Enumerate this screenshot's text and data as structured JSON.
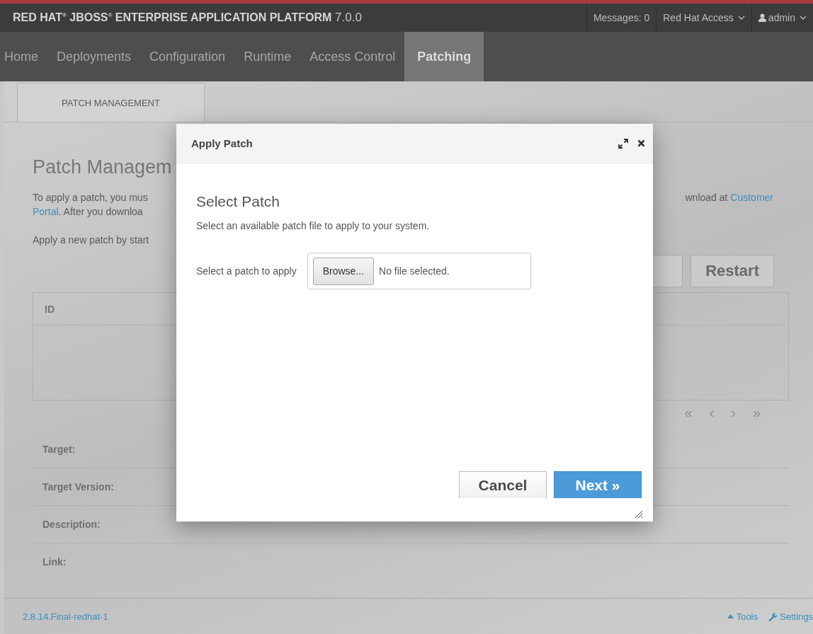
{
  "header": {
    "brand": "RED HAT$^{®}$ JBOSS$^{®}$ ENTERPRISE APPLICATION PLATFORM",
    "version": "7.0.0",
    "messages": "Messages: 0",
    "access_menu": "Red Hat Access",
    "user_menu": "admin"
  },
  "nav": [
    {
      "label": "Home",
      "selected": false
    },
    {
      "label": "Deployments",
      "selected": false
    },
    {
      "label": "Configuration",
      "selected": false
    },
    {
      "label": "Runtime",
      "selected": false
    },
    {
      "label": "Access Control",
      "selected": false
    },
    {
      "label": "Patching",
      "selected": true
    }
  ],
  "page_tabs": [
    {
      "label": "PATCH MANAGEMENT",
      "selected": true
    }
  ],
  "background": {
    "heading": "Patch Managem",
    "intro_lines": [
      {
        "left": [
          {
            "text": "To apply a patch, you mus",
            "link": false
          }
        ],
        "right": [
          {
            "text": "wnload at ",
            "link": false
          },
          {
            "text": "Customer",
            "link": true
          }
        ]
      },
      {
        "left": [
          {
            "text": "Portal",
            "link": true
          },
          {
            "text": ". After you downloa",
            "link": false
          }
        ]
      }
    ],
    "hint": "Apply a new patch by start",
    "restart_button": "Restart",
    "table": {
      "columns": [
        "ID"
      ]
    },
    "pager": [
      {
        "text": "«",
        "disabled": true
      },
      {
        "text": "‹",
        "disabled": true
      },
      {
        "text": "›",
        "disabled": true
      },
      {
        "text": "»",
        "disabled": true
      }
    ],
    "details": [
      "Target:",
      "Target Version:",
      "Description:",
      "Link:"
    ]
  },
  "footer": {
    "version": "2.8.14.Final-redhat-1",
    "tools": "Tools",
    "settings": "Settings"
  },
  "dialog": {
    "title": "Apply Patch",
    "step_title": "Select Patch",
    "description": "Select an available patch file to apply to your system.",
    "field_label": "Select a patch to apply",
    "browse": "Browse...",
    "file_status": "No file selected.",
    "buttons": [
      {
        "label": "Cancel",
        "kind": "default"
      },
      {
        "label": "Next »",
        "kind": "primary"
      }
    ]
  }
}
